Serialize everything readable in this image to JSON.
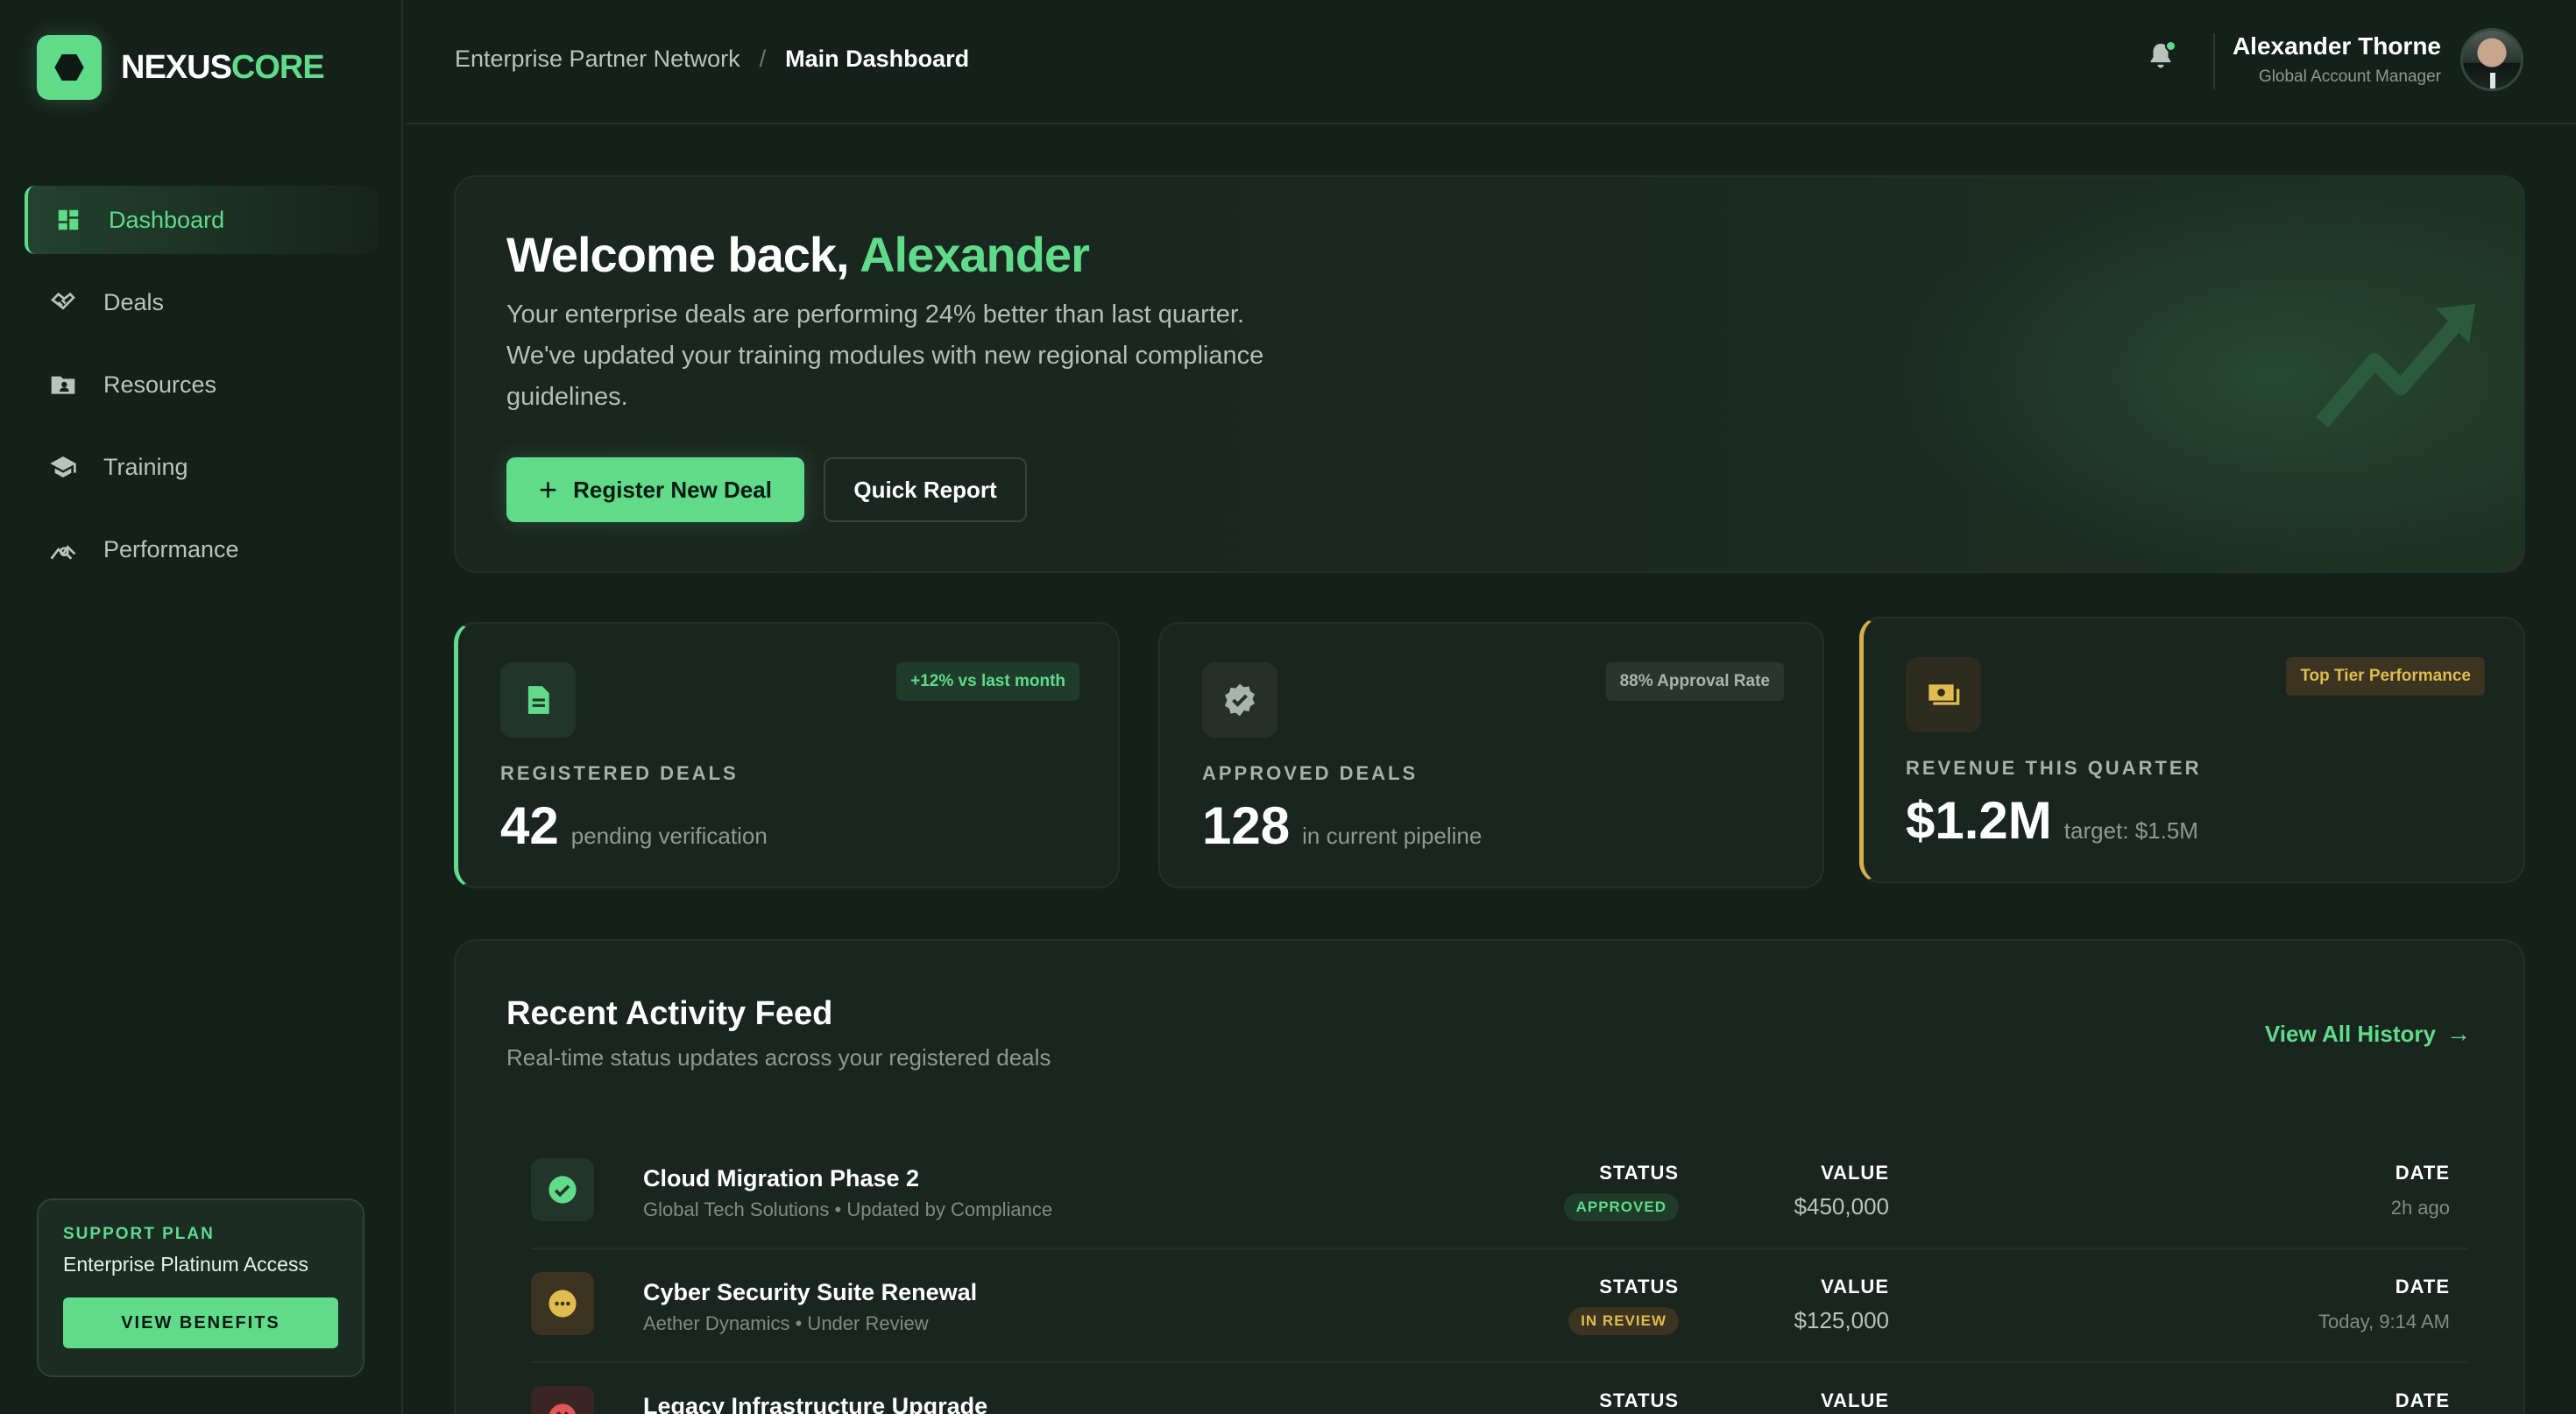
{
  "brand": {
    "name_part1": "NEXUS",
    "name_part2": "CORE",
    "accent": "#5fdb8a"
  },
  "sidebar": {
    "items": [
      {
        "label": "Dashboard",
        "icon": "dashboard-grid-icon",
        "active": true
      },
      {
        "label": "Deals",
        "icon": "handshake-icon"
      },
      {
        "label": "Resources",
        "icon": "folder-user-icon"
      },
      {
        "label": "Training",
        "icon": "graduation-cap-icon"
      },
      {
        "label": "Performance",
        "icon": "analytics-icon"
      }
    ],
    "support": {
      "kicker": "SUPPORT PLAN",
      "title": "Enterprise Platinum Access",
      "button": "VIEW BENEFITS"
    }
  },
  "header": {
    "breadcrumb": {
      "parent": "Enterprise Partner Network",
      "separator": "/",
      "current": "Main Dashboard"
    },
    "user": {
      "name": "Alexander Thorne",
      "role": "Global Account Manager"
    }
  },
  "hero": {
    "title_prefix": "Welcome back, ",
    "title_name": "Alexander",
    "body": "Your enterprise deals are performing 24% better than last quarter. We've updated your training modules with new regional compliance guidelines.",
    "primary_button": "Register New Deal",
    "secondary_button": "Quick Report"
  },
  "stats": [
    {
      "label": "REGISTERED DEALS",
      "value": "42",
      "sub": "pending verification",
      "badge": "+12% vs last month",
      "icon": "document-icon"
    },
    {
      "label": "APPROVED DEALS",
      "value": "128",
      "sub": "in current pipeline",
      "badge": "88% Approval Rate",
      "icon": "verified-badge-icon"
    },
    {
      "label": "REVENUE THIS QUARTER",
      "value": "$1.2M",
      "sub": "target: $1.5M",
      "badge": "Top Tier Performance",
      "icon": "cash-icon"
    }
  ],
  "activity": {
    "title": "Recent Activity Feed",
    "subtitle": "Real-time status updates across your registered deals",
    "link": "View All History",
    "col_status": "STATUS",
    "col_value": "VALUE",
    "col_date": "DATE",
    "rows": [
      {
        "title": "Cloud Migration Phase 2",
        "meta": "Global Tech Solutions • Updated by Compliance",
        "status": "APPROVED",
        "value": "$450,000",
        "date": "2h ago",
        "icon": "check-circle-icon"
      },
      {
        "title": "Cyber Security Suite Renewal",
        "meta": "Aether Dynamics • Under Review",
        "status": "IN REVIEW",
        "value": "$125,000",
        "date": "Today, 9:14 AM",
        "icon": "more-circle-icon"
      },
      {
        "title": "Legacy Infrastructure Upgrade",
        "meta": "",
        "status": "",
        "value": "",
        "date": "",
        "icon": "x-circle-icon"
      }
    ]
  }
}
